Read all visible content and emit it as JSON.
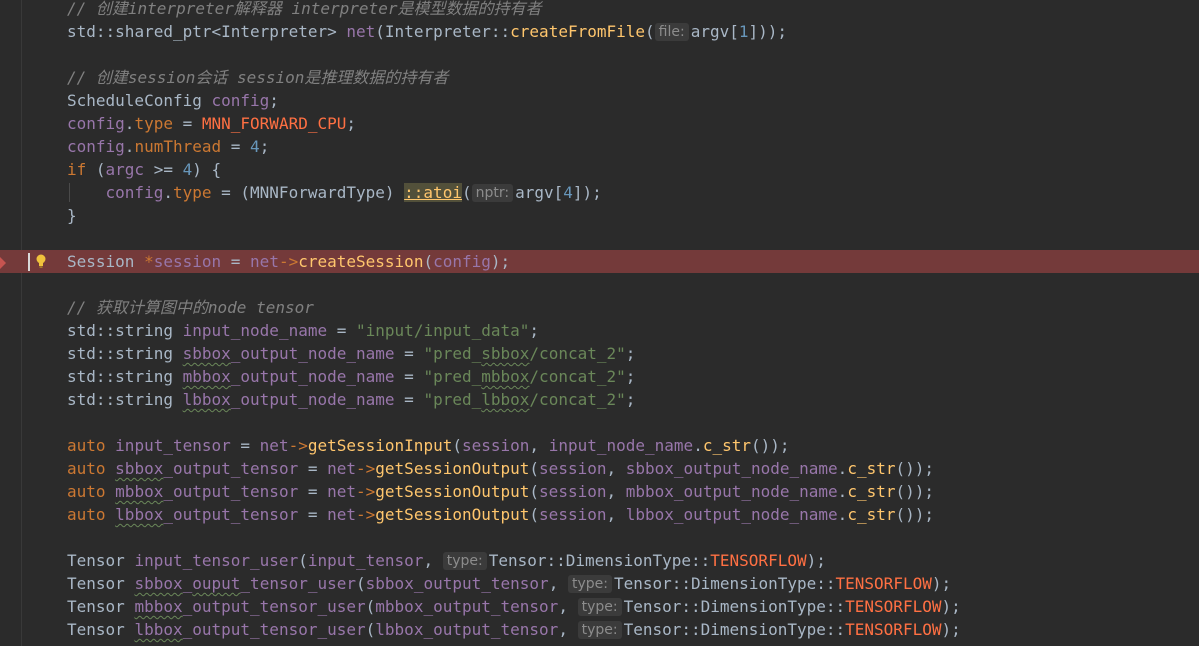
{
  "editor": {
    "colors": {
      "background": "#2b2b2b",
      "highlight_line": "#743a3a",
      "comment": "#808080",
      "keyword": "#cc7832",
      "function": "#ffc66d",
      "string": "#6a8759",
      "number": "#6897bb",
      "constant": "#ff7043"
    },
    "icons": {
      "breakpoint": "breakpoint-icon",
      "intention": "lightbulb-icon"
    },
    "lines": [
      {
        "tokens": [
          [
            "cm",
            "// 创建interpreter解释器 interpreter是模型数据的持有者"
          ]
        ]
      },
      {
        "tokens": [
          [
            "plain",
            "std"
          ],
          [
            "op",
            "::"
          ],
          [
            "plain",
            "shared_ptr"
          ],
          [
            "op",
            "<"
          ],
          [
            "plain",
            "Interpreter"
          ],
          [
            "op",
            "> "
          ],
          [
            "var2",
            "net"
          ],
          [
            "op",
            "("
          ],
          [
            "plain",
            "Interpreter"
          ],
          [
            "op",
            "::"
          ],
          [
            "fn",
            "createFromFile"
          ],
          [
            "op",
            "("
          ],
          [
            "hint",
            "file:"
          ],
          [
            "plain",
            "argv"
          ],
          [
            "op",
            "["
          ],
          [
            "num",
            "1"
          ],
          [
            "op",
            "]));"
          ]
        ]
      },
      {
        "tokens": []
      },
      {
        "tokens": [
          [
            "cm",
            "// 创建session会话 session是推理数据的持有者"
          ]
        ]
      },
      {
        "tokens": [
          [
            "plain",
            "ScheduleConfig "
          ],
          [
            "var2",
            "config"
          ],
          [
            "op",
            ";"
          ]
        ]
      },
      {
        "tokens": [
          [
            "var2",
            "config"
          ],
          [
            "op",
            "."
          ],
          [
            "kw",
            "type"
          ],
          [
            "op",
            " = "
          ],
          [
            "enum",
            "MNN_FORWARD_CPU"
          ],
          [
            "op",
            ";"
          ]
        ]
      },
      {
        "tokens": [
          [
            "var2",
            "config"
          ],
          [
            "op",
            "."
          ],
          [
            "kw",
            "numThread"
          ],
          [
            "op",
            " = "
          ],
          [
            "num",
            "4"
          ],
          [
            "op",
            ";"
          ]
        ]
      },
      {
        "tokens": [
          [
            "kw",
            "if"
          ],
          [
            "op",
            " ("
          ],
          [
            "var2",
            "argc"
          ],
          [
            "op",
            " >= "
          ],
          [
            "num",
            "4"
          ],
          [
            "op",
            ") {"
          ]
        ]
      },
      {
        "indent": true,
        "tokens": [
          [
            "plain",
            "    "
          ],
          [
            "var2",
            "config"
          ],
          [
            "op",
            "."
          ],
          [
            "kw",
            "type"
          ],
          [
            "op",
            " = (MNNForwardType) "
          ],
          [
            "hl",
            "::atoi"
          ],
          [
            "op",
            "("
          ],
          [
            "hint",
            "nptr:"
          ],
          [
            "plain",
            "argv"
          ],
          [
            "op",
            "["
          ],
          [
            "num",
            "4"
          ],
          [
            "op",
            "]);"
          ]
        ]
      },
      {
        "tokens": [
          [
            "op",
            "}"
          ]
        ]
      },
      {
        "tokens": []
      },
      {
        "highlight": true,
        "tokens": [
          [
            "plain",
            "Session "
          ],
          [
            "kw",
            "*"
          ],
          [
            "var2",
            "session"
          ],
          [
            "op",
            " = "
          ],
          [
            "var2",
            "net"
          ],
          [
            "kw",
            "->"
          ],
          [
            "fn",
            "createSession"
          ],
          [
            "op",
            "("
          ],
          [
            "var2",
            "config"
          ],
          [
            "op",
            ");"
          ]
        ]
      },
      {
        "tokens": []
      },
      {
        "tokens": [
          [
            "cm",
            "// 获取计算图中的node tensor"
          ]
        ]
      },
      {
        "tokens": [
          [
            "plain",
            "std"
          ],
          [
            "op",
            "::"
          ],
          [
            "plain",
            "string "
          ],
          [
            "var2",
            "input_node_name"
          ],
          [
            "op",
            " = "
          ],
          [
            "str",
            "\"input/input_data\""
          ],
          [
            "op",
            ";"
          ]
        ]
      },
      {
        "tokens": [
          [
            "plain",
            "std"
          ],
          [
            "op",
            "::"
          ],
          [
            "plain",
            "string "
          ],
          [
            "var2sq",
            "sbbox"
          ],
          [
            "var2",
            "_output_node_name"
          ],
          [
            "op",
            " = "
          ],
          [
            "str",
            "\"pred_"
          ],
          [
            "strsq",
            "sbbox"
          ],
          [
            "str",
            "/concat_2\""
          ],
          [
            "op",
            ";"
          ]
        ]
      },
      {
        "tokens": [
          [
            "plain",
            "std"
          ],
          [
            "op",
            "::"
          ],
          [
            "plain",
            "string "
          ],
          [
            "var2sq",
            "mbbox"
          ],
          [
            "var2",
            "_output_node_name"
          ],
          [
            "op",
            " = "
          ],
          [
            "str",
            "\"pred_"
          ],
          [
            "strsq",
            "mbbox"
          ],
          [
            "str",
            "/concat_2\""
          ],
          [
            "op",
            ";"
          ]
        ]
      },
      {
        "tokens": [
          [
            "plain",
            "std"
          ],
          [
            "op",
            "::"
          ],
          [
            "plain",
            "string "
          ],
          [
            "var2sq",
            "lbbox"
          ],
          [
            "var2",
            "_output_node_name"
          ],
          [
            "op",
            " = "
          ],
          [
            "str",
            "\"pred_"
          ],
          [
            "strsq",
            "lbbox"
          ],
          [
            "str",
            "/concat_2\""
          ],
          [
            "op",
            ";"
          ]
        ]
      },
      {
        "tokens": []
      },
      {
        "tokens": [
          [
            "kw",
            "auto "
          ],
          [
            "var2",
            "input_tensor"
          ],
          [
            "op",
            " = "
          ],
          [
            "var2",
            "net"
          ],
          [
            "kw",
            "->"
          ],
          [
            "fn",
            "getSessionInput"
          ],
          [
            "op",
            "("
          ],
          [
            "var2",
            "session"
          ],
          [
            "op",
            ", "
          ],
          [
            "var2",
            "input_node_name"
          ],
          [
            "op",
            "."
          ],
          [
            "fn",
            "c_str"
          ],
          [
            "op",
            "());"
          ]
        ]
      },
      {
        "tokens": [
          [
            "kw",
            "auto "
          ],
          [
            "var2sq",
            "sbbox"
          ],
          [
            "var2",
            "_output_tensor"
          ],
          [
            "op",
            " = "
          ],
          [
            "var2",
            "net"
          ],
          [
            "kw",
            "->"
          ],
          [
            "fn",
            "getSessionOutput"
          ],
          [
            "op",
            "("
          ],
          [
            "var2",
            "session"
          ],
          [
            "op",
            ", "
          ],
          [
            "var2",
            "sbbox_output_node_name"
          ],
          [
            "op",
            "."
          ],
          [
            "fn",
            "c_str"
          ],
          [
            "op",
            "());"
          ]
        ]
      },
      {
        "tokens": [
          [
            "kw",
            "auto "
          ],
          [
            "var2sq",
            "mbbox"
          ],
          [
            "var2",
            "_output_tensor"
          ],
          [
            "op",
            " = "
          ],
          [
            "var2",
            "net"
          ],
          [
            "kw",
            "->"
          ],
          [
            "fn",
            "getSessionOutput"
          ],
          [
            "op",
            "("
          ],
          [
            "var2",
            "session"
          ],
          [
            "op",
            ", "
          ],
          [
            "var2",
            "mbbox_output_node_name"
          ],
          [
            "op",
            "."
          ],
          [
            "fn",
            "c_str"
          ],
          [
            "op",
            "());"
          ]
        ]
      },
      {
        "tokens": [
          [
            "kw",
            "auto "
          ],
          [
            "var2sq",
            "lbbox"
          ],
          [
            "var2",
            "_output_tensor"
          ],
          [
            "op",
            " = "
          ],
          [
            "var2",
            "net"
          ],
          [
            "kw",
            "->"
          ],
          [
            "fn",
            "getSessionOutput"
          ],
          [
            "op",
            "("
          ],
          [
            "var2",
            "session"
          ],
          [
            "op",
            ", "
          ],
          [
            "var2",
            "lbbox_output_node_name"
          ],
          [
            "op",
            "."
          ],
          [
            "fn",
            "c_str"
          ],
          [
            "op",
            "());"
          ]
        ]
      },
      {
        "tokens": []
      },
      {
        "tokens": [
          [
            "plain",
            "Tensor "
          ],
          [
            "var2",
            "input_tensor_user"
          ],
          [
            "op",
            "("
          ],
          [
            "var2",
            "input_tensor"
          ],
          [
            "op",
            ", "
          ],
          [
            "hint",
            "type:"
          ],
          [
            "plain",
            "Tensor"
          ],
          [
            "op",
            "::"
          ],
          [
            "plain",
            "DimensionType"
          ],
          [
            "op",
            "::"
          ],
          [
            "enum",
            "TENSORFLOW"
          ],
          [
            "op",
            ");"
          ]
        ]
      },
      {
        "tokens": [
          [
            "plain",
            "Tensor "
          ],
          [
            "var2sq",
            "sbbox"
          ],
          [
            "var2",
            "_"
          ],
          [
            "var2sq",
            "ouput"
          ],
          [
            "var2",
            "_tensor_user"
          ],
          [
            "op",
            "("
          ],
          [
            "var2",
            "sbbox_output_tensor"
          ],
          [
            "op",
            ", "
          ],
          [
            "hint",
            "type:"
          ],
          [
            "plain",
            "Tensor"
          ],
          [
            "op",
            "::"
          ],
          [
            "plain",
            "DimensionType"
          ],
          [
            "op",
            "::"
          ],
          [
            "enum",
            "TENSORFLOW"
          ],
          [
            "op",
            ");"
          ]
        ]
      },
      {
        "tokens": [
          [
            "plain",
            "Tensor "
          ],
          [
            "var2sq",
            "mbbox"
          ],
          [
            "var2",
            "_output_tensor_user"
          ],
          [
            "op",
            "("
          ],
          [
            "var2",
            "mbbox_output_tensor"
          ],
          [
            "op",
            ", "
          ],
          [
            "hint",
            "type:"
          ],
          [
            "plain",
            "Tensor"
          ],
          [
            "op",
            "::"
          ],
          [
            "plain",
            "DimensionType"
          ],
          [
            "op",
            "::"
          ],
          [
            "enum",
            "TENSORFLOW"
          ],
          [
            "op",
            ");"
          ]
        ]
      },
      {
        "tokens": [
          [
            "plain",
            "Tensor "
          ],
          [
            "var2sq",
            "lbbox"
          ],
          [
            "var2",
            "_output_tensor_user"
          ],
          [
            "op",
            "("
          ],
          [
            "var2",
            "lbbox_output_tensor"
          ],
          [
            "op",
            ", "
          ],
          [
            "hint",
            "type:"
          ],
          [
            "plain",
            "Tensor"
          ],
          [
            "op",
            "::"
          ],
          [
            "plain",
            "DimensionType"
          ],
          [
            "op",
            "::"
          ],
          [
            "enum",
            "TENSORFLOW"
          ],
          [
            "op",
            ");"
          ]
        ]
      }
    ]
  }
}
